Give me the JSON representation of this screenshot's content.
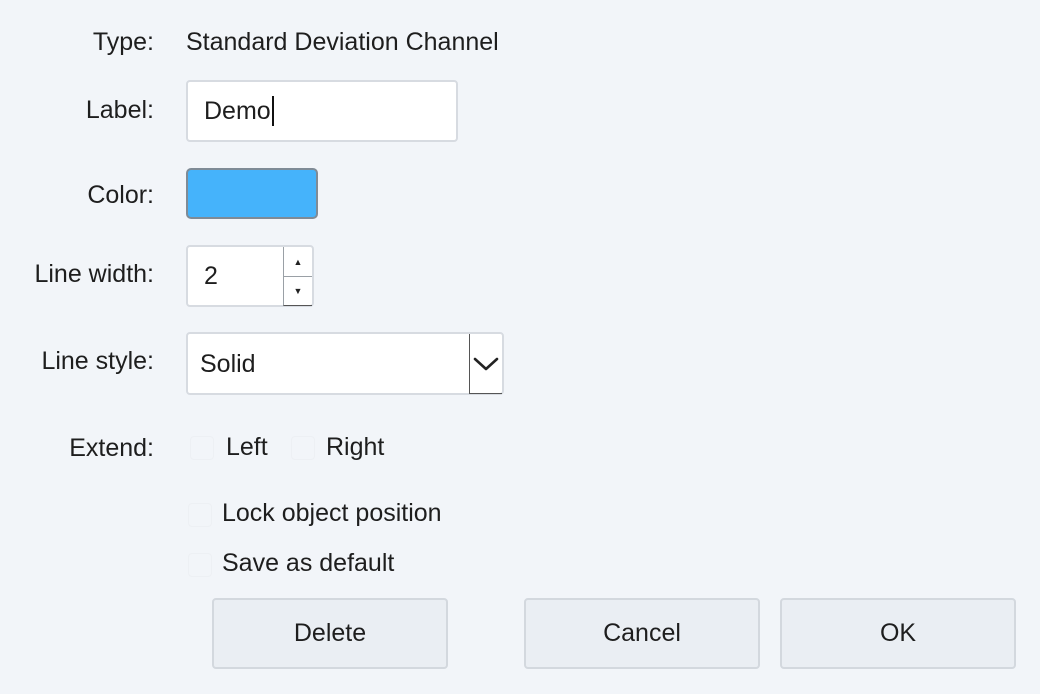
{
  "fields": {
    "type_label": "Type:",
    "type_value": "Standard Deviation Channel",
    "label_label": "Label:",
    "label_value": "Demo",
    "color_label": "Color:",
    "color_value": "#45b3fb",
    "linewidth_label": "Line width:",
    "linewidth_value": "2",
    "linestyle_label": "Line style:",
    "linestyle_value": "Solid",
    "extend_label": "Extend:"
  },
  "extend": {
    "left_label": "Left",
    "left_checked": false,
    "right_label": "Right",
    "right_checked": false
  },
  "options": {
    "lock_label": "Lock object position",
    "lock_checked": false,
    "default_label": "Save as default",
    "default_checked": false
  },
  "buttons": {
    "delete_label": "Delete",
    "cancel_label": "Cancel",
    "ok_label": "OK"
  },
  "icons": {
    "spin_up": "caret-up-icon",
    "spin_down": "caret-down-icon",
    "select_arrow": "chevron-down-icon"
  }
}
